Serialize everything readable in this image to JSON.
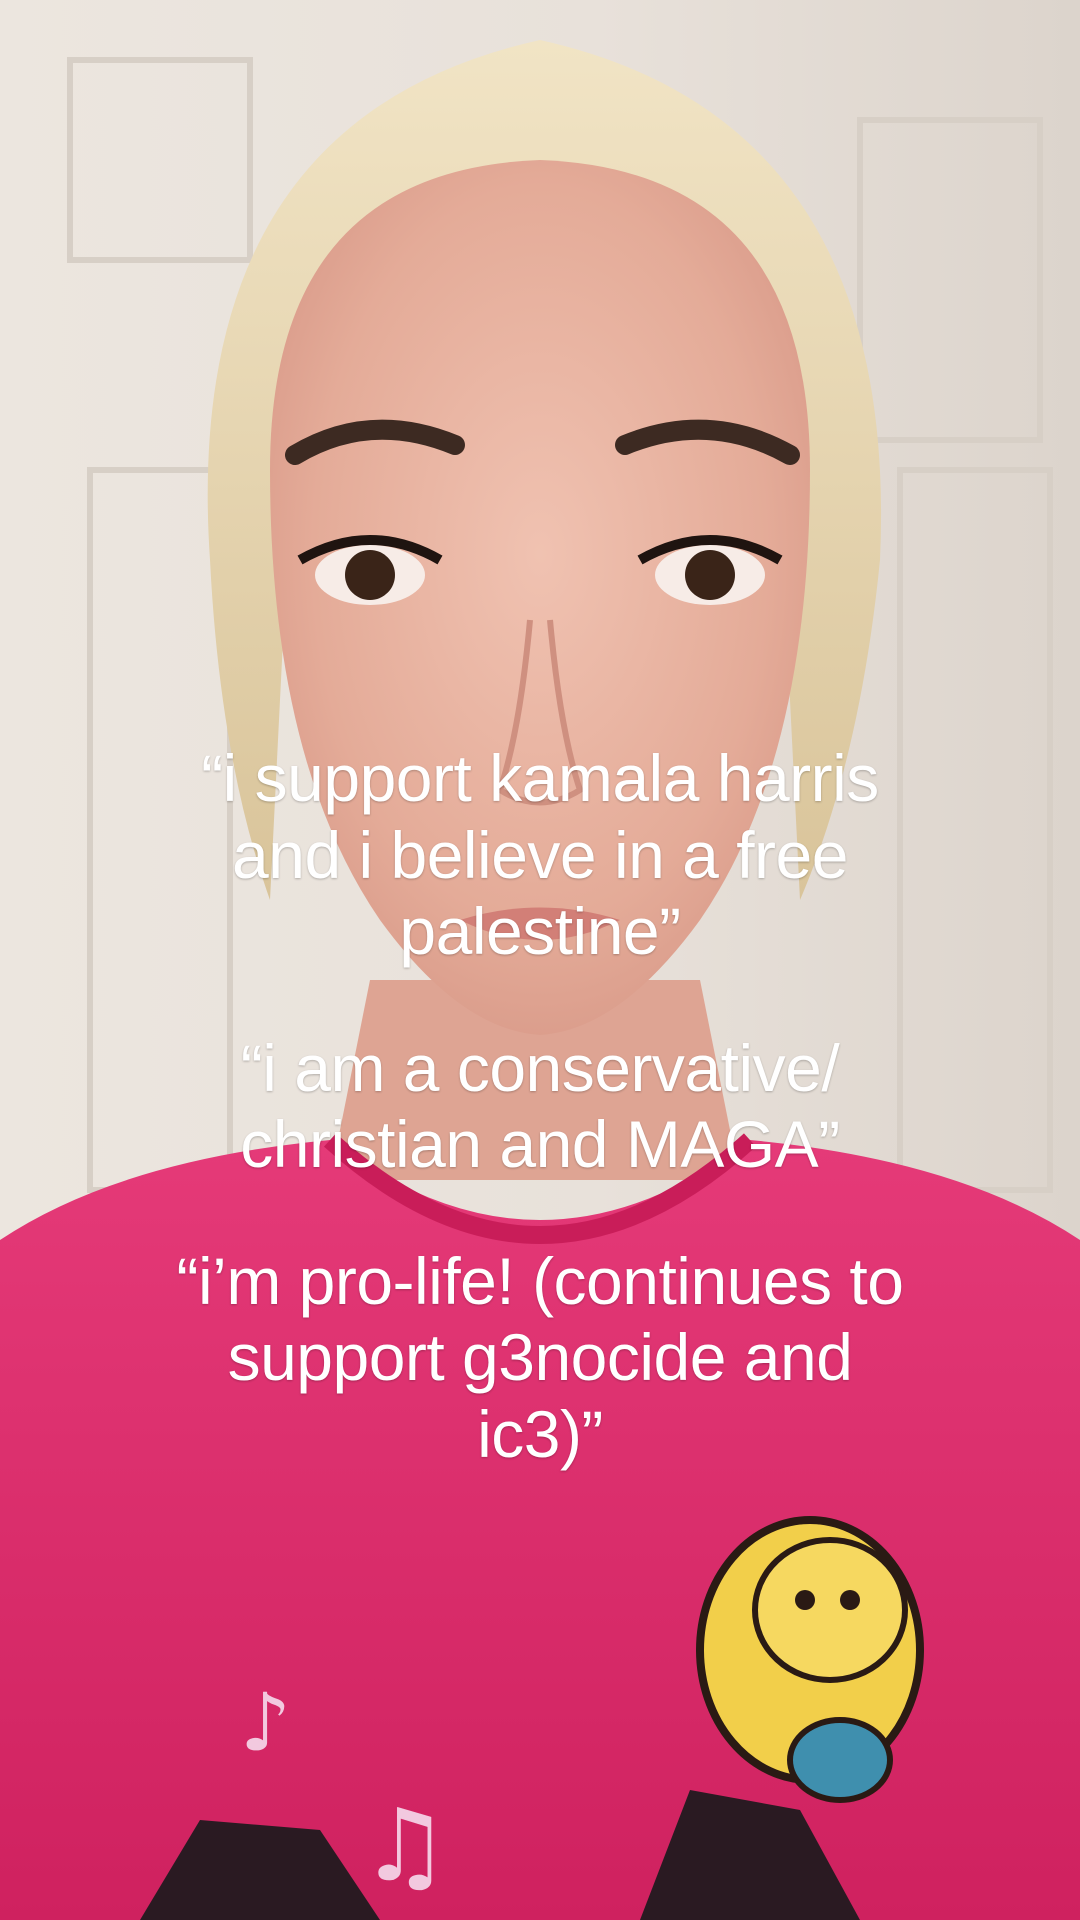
{
  "overlay": {
    "captions": [
      "“i support kamala harris\nand i believe in a free\npalestine”",
      "“i am a conservative/\nchristian and MAGA”",
      "“i’m pro-life! (continues to\nsupport g3nocide and\nic3)”"
    ]
  },
  "colors": {
    "wall": "#e9e3dc",
    "skin": "#e8b4a2",
    "hair": "#e6d3a6",
    "shirt": "#e0306f",
    "text": "#ffffff"
  }
}
